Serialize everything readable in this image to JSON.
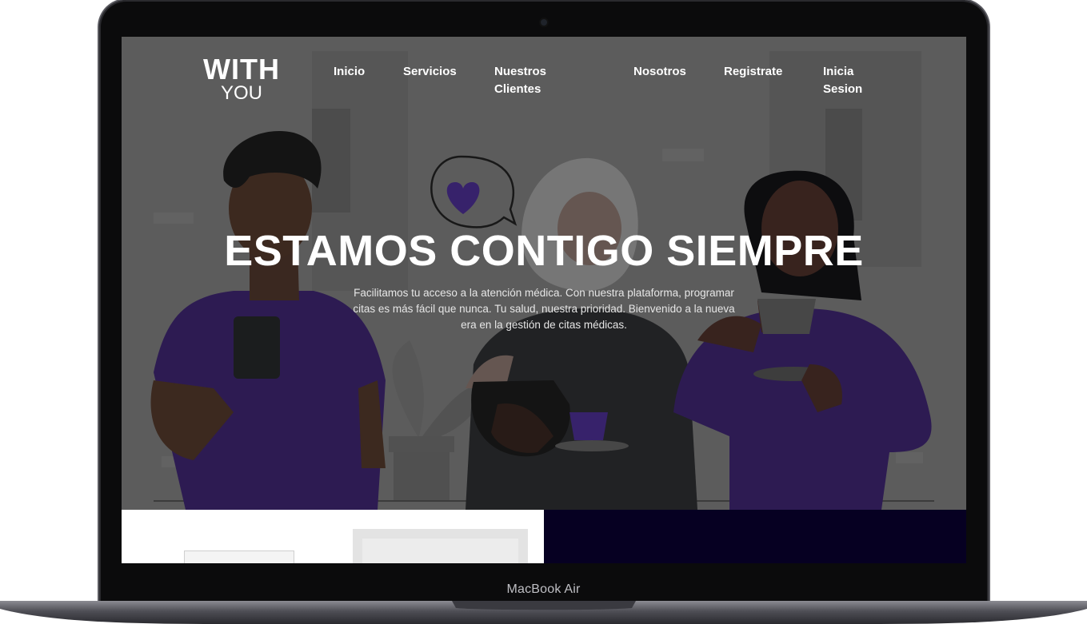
{
  "device": {
    "label": "MacBook Air"
  },
  "brand": {
    "line1": "WITH",
    "line2": "YOU"
  },
  "nav": {
    "items": [
      {
        "label": "Inicio"
      },
      {
        "label": "Servicios"
      },
      {
        "label": "Nuestros Clientes"
      },
      {
        "label": "Nosotros"
      },
      {
        "label": "Registrate"
      },
      {
        "label": "Inicia Sesion"
      }
    ]
  },
  "hero": {
    "title": "ESTAMOS CONTIGO SIEMPRE",
    "description": "Facilitamos tu acceso a la atención médica. Con nuestra plataforma, programar citas es más fácil que nunca. Tu salud, nuestra prioridad. Bienvenido a la nueva era en la gestión de citas médicas.",
    "illustration": "three-people-drinking-coffee-illustration"
  },
  "colors": {
    "accent_purple": "#3a2470",
    "dark_navy": "#060022",
    "hero_overlay": "#5e5e5e"
  }
}
